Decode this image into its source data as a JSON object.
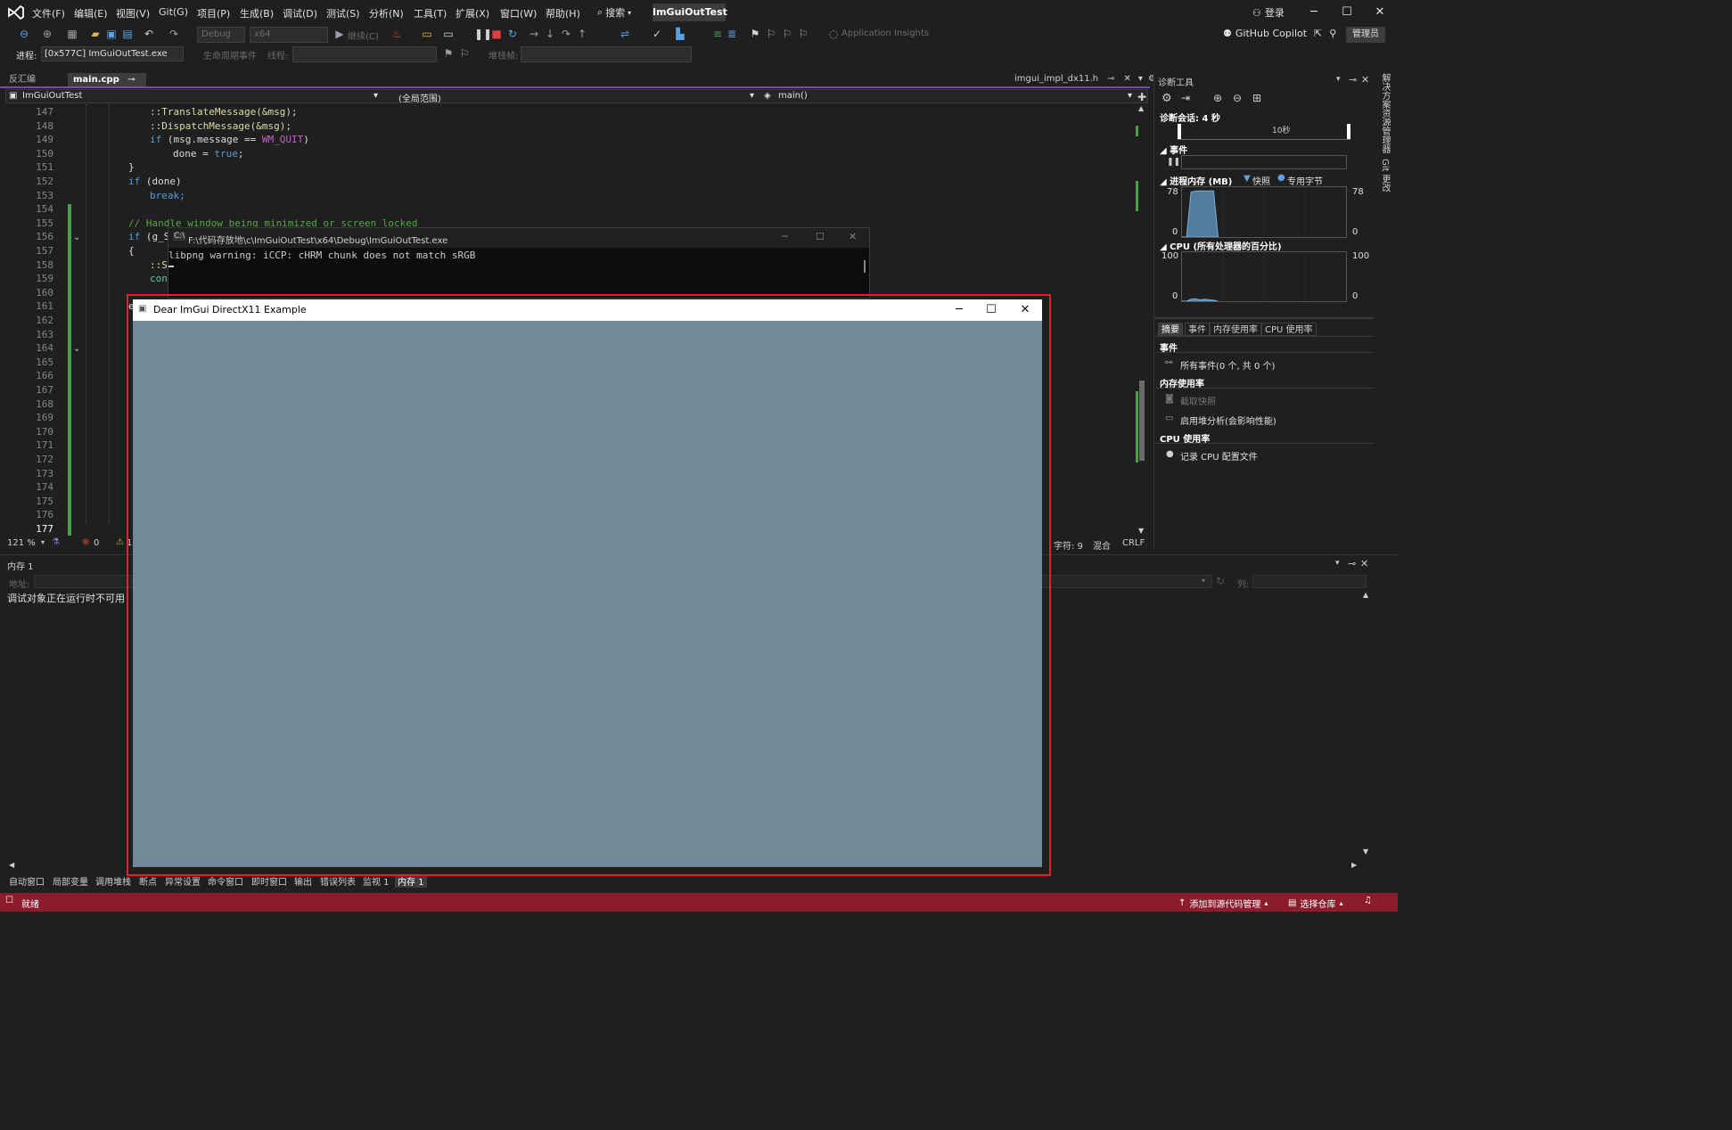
{
  "menu": {
    "items": [
      "文件(F)",
      "编辑(E)",
      "视图(V)",
      "Git(G)",
      "项目(P)",
      "生成(B)",
      "调试(D)",
      "测试(S)",
      "分析(N)",
      "工具(T)",
      "扩展(X)",
      "窗口(W)",
      "帮助(H)"
    ],
    "search": "搜索",
    "solution": "ImGuiOutTest",
    "login": "登录"
  },
  "toolbar": {
    "config": "Debug",
    "platform": "x64",
    "continue": "继续(C)",
    "app_insights": "Application Insights",
    "copilot": "GitHub Copilot",
    "admin": "管理员",
    "process_label": "进程:",
    "process_value": "[0x577C] ImGuiOutTest.exe",
    "lifecycle": "生命周期事件",
    "thread_label": "线程:",
    "stack_label": "堆栈帧:"
  },
  "tabs": {
    "disasm": "反汇编",
    "main": "main.cpp",
    "right": "imgui_impl_dx11.h"
  },
  "navbar": {
    "project": "ImGuiOutTest",
    "scope": "(全局范围)",
    "member": "main()"
  },
  "editor": {
    "lines": [
      "147",
      "148",
      "149",
      "150",
      "151",
      "152",
      "153",
      "154",
      "155",
      "156",
      "157",
      "158",
      "159",
      "160",
      "161",
      "162",
      "163",
      "164",
      "165",
      "166",
      "167",
      "168",
      "169",
      "170",
      "171",
      "172",
      "173",
      "174",
      "175",
      "176",
      "177"
    ],
    "code": {
      "l147": "::TranslateMessage(&msg);",
      "l148": "::DispatchMessage(&msg);",
      "l149_a": "if",
      "l149_b": " (msg.message == ",
      "l149_c": "WM_QUIT",
      "l149_d": ")",
      "l150_a": "done = ",
      "l150_b": "true",
      "l150_c": ";",
      "l151": "}",
      "l152_a": "if",
      "l152_b": " (done)",
      "l153": "break;",
      "l155": "// Handle window being minimized or screen locked",
      "l156_a": "if",
      "l156_b": " (g_S",
      "l157": "{",
      "l158": "::S",
      "l159": "con",
      "l161": "e"
    }
  },
  "editor_status": {
    "zoom": "121 %",
    "errors": "0",
    "warnings": "1",
    "char": "字符: 9",
    "mixed": "混合",
    "eol": "CRLF"
  },
  "memory": {
    "title": "内存 1",
    "addr_label": "地址:",
    "col_label": "列:",
    "message": "调试对象正在运行时不可用"
  },
  "bottom_tabs": [
    "自动窗口",
    "局部变量",
    "调用堆栈",
    "断点",
    "异常设置",
    "命令窗口",
    "即时窗口",
    "输出",
    "错误列表",
    "监视 1",
    "内存 1"
  ],
  "status": {
    "ready": "就绪",
    "add_source": "添加到源代码管理",
    "select_repo": "选择仓库"
  },
  "diag": {
    "title": "诊断工具",
    "session": "诊断会话: 4 秒",
    "timeline_label": "10秒",
    "events_header": "事件",
    "memory_header": "进程内存 (MB)",
    "snapshot_legend": "快照",
    "private_legend": "专用字节",
    "mem_max": "78",
    "mem_min": "0",
    "cpu_header": "CPU (所有处理器的百分比)",
    "cpu_max": "100",
    "cpu_min": "0",
    "tabs": [
      "摘要",
      "事件",
      "内存使用率",
      "CPU 使用率"
    ],
    "sum_events": "事件",
    "all_events": "所有事件(0 个, 共 0 个)",
    "sum_mem": "内存使用率",
    "take_snapshot": "截取快照",
    "heap_profile": "启用堆分析(会影响性能)",
    "sum_cpu": "CPU 使用率",
    "record_cpu": "记录 CPU 配置文件"
  },
  "side_tabs": [
    "解决方案资源管理器",
    "Git 更改"
  ],
  "console": {
    "title": "F:\\代码存放地\\c\\ImGuiOutTest\\x64\\Debug\\ImGuiOutTest.exe",
    "text": "libpng warning: iCCP: cHRM chunk does not match sRGB"
  },
  "imgui": {
    "title": "Dear ImGui DirectX11 Example",
    "bg_color": "#718a98"
  },
  "chart_data": [
    {
      "type": "area",
      "title": "进程内存 (MB)",
      "ylim": [
        0,
        78
      ],
      "x": [
        0,
        0.5,
        1,
        1.5,
        2,
        2.5,
        3,
        3.5,
        4
      ],
      "series": [
        {
          "name": "专用字节",
          "values": [
            0,
            0,
            70,
            72,
            72,
            72,
            72,
            72,
            0
          ]
        }
      ]
    },
    {
      "type": "area",
      "title": "CPU (所有处理器的百分比)",
      "ylim": [
        0,
        100
      ],
      "x": [
        0,
        0.5,
        1,
        1.5,
        2,
        2.5,
        3,
        3.5,
        4
      ],
      "series": [
        {
          "values": [
            0,
            0,
            4,
            5,
            3,
            4,
            3,
            2,
            0
          ]
        }
      ]
    }
  ]
}
